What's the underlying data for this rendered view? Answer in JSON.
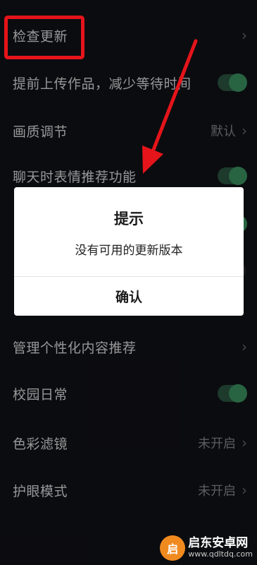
{
  "settings": {
    "items": [
      {
        "label": "检查更新",
        "type": "chevron"
      },
      {
        "label": "提前上传作品，减少等待时间",
        "type": "toggle",
        "on": true
      },
      {
        "label": "画质调节",
        "type": "value",
        "value": "默认"
      },
      {
        "label": "聊天时表情推荐功能",
        "type": "toggle",
        "on": true
      },
      {
        "label": "",
        "type": "toggle",
        "on": true
      },
      {
        "label": "",
        "type": "toggle",
        "on": false
      },
      {
        "label": "",
        "type": "none"
      },
      {
        "label": "管理个性化内容推荐",
        "type": "chevron"
      },
      {
        "label": "校园日常",
        "type": "toggle",
        "on": true
      },
      {
        "label": "色彩滤镜",
        "type": "value",
        "value": "未开启"
      },
      {
        "label": "护眼模式",
        "type": "value",
        "value": "未开启"
      }
    ]
  },
  "dialog": {
    "title": "提示",
    "message": "没有可用的更新版本",
    "confirm_label": "确认"
  },
  "watermark": {
    "name": "启东安卓网",
    "url": "www.qdltdq.com"
  },
  "colors": {
    "accent_green": "#3e9a66",
    "highlight_red": "#e5141b"
  }
}
